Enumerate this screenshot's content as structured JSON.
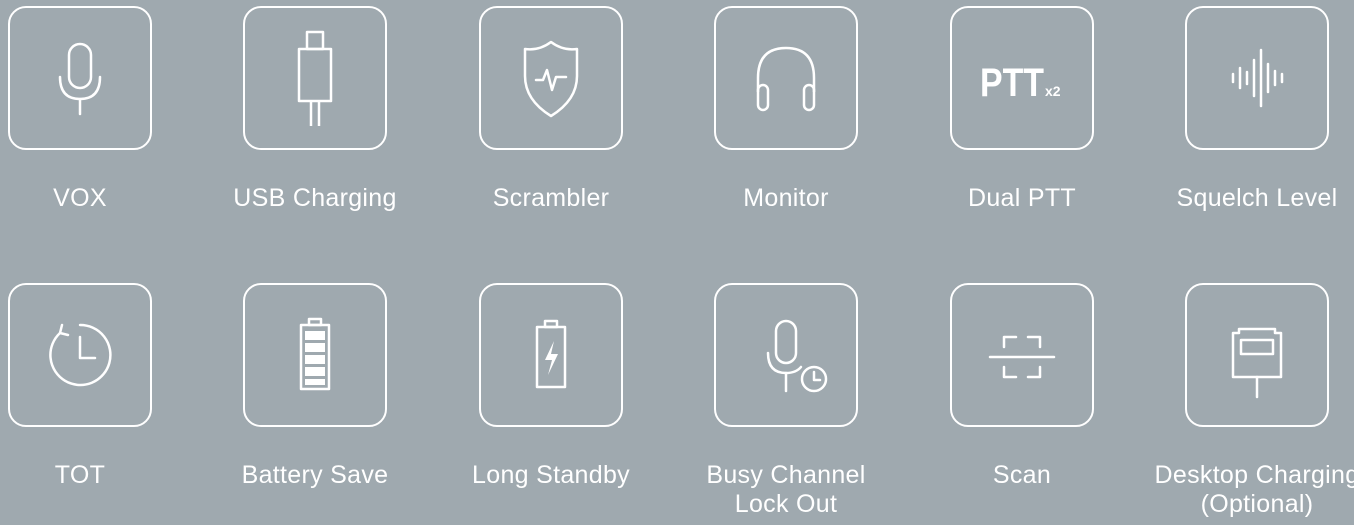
{
  "features": [
    {
      "label": "VOX",
      "icon": "microphone-icon"
    },
    {
      "label": "USB Charging",
      "icon": "usb-cable-icon"
    },
    {
      "label": "Scrambler",
      "icon": "shield-pulse-icon"
    },
    {
      "label": "Monitor",
      "icon": "headphones-icon"
    },
    {
      "label": "Dual PTT",
      "icon": "ptt-x2-icon",
      "icon_text": "PTT",
      "icon_subtext": "x2"
    },
    {
      "label": "Squelch Level",
      "icon": "sound-wave-icon"
    },
    {
      "label": "TOT",
      "icon": "timer-icon"
    },
    {
      "label": "Battery Save",
      "icon": "full-battery-icon"
    },
    {
      "label": "Long Standby",
      "icon": "charging-battery-icon"
    },
    {
      "label": "Busy Channel\nLock Out",
      "icon": "microphone-clock-icon"
    },
    {
      "label": "Scan",
      "icon": "scan-frame-icon"
    },
    {
      "label": "Desktop Charging\n(Optional)",
      "icon": "desktop-charger-icon"
    }
  ],
  "colors": {
    "background": "#9fa9af",
    "foreground": "#ffffff"
  }
}
